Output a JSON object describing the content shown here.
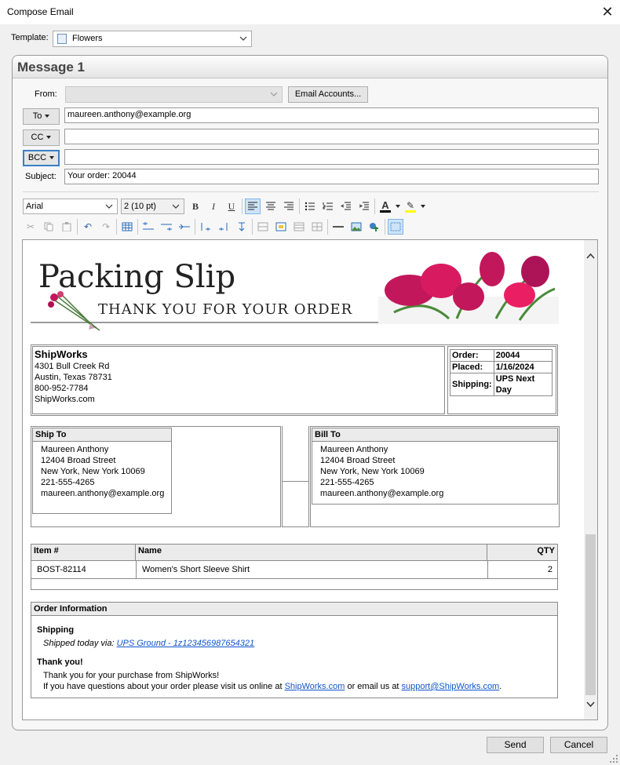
{
  "window": {
    "title": "Compose Email",
    "close_glyph": "✕"
  },
  "template": {
    "label": "Template:",
    "value": "Flowers"
  },
  "message": {
    "title": "Message 1",
    "from_label": "From:",
    "from_value": "",
    "email_accounts_label": "Email Accounts...",
    "to_label": "To",
    "to_value": "maureen.anthony@example.org",
    "cc_label": "CC",
    "cc_value": "",
    "bcc_label": "BCC",
    "bcc_value": "",
    "subject_label": "Subject:",
    "subject_value": "Your order: 20044"
  },
  "format": {
    "font": "Arial",
    "size": "2  (10 pt)",
    "bold": "B",
    "italic": "I",
    "underline": "U",
    "font_color_glyph": "A",
    "highlight_glyph": "✎"
  },
  "slip": {
    "title": "Packing Slip",
    "subtitle": "THANK YOU FOR YOUR ORDER",
    "company": {
      "name": "ShipWorks",
      "street": "4301 Bull Creek Rd",
      "city": "Austin, Texas 78731",
      "phone": "800-952-7784",
      "web": "ShipWorks.com"
    },
    "order": {
      "order_label": "Order:",
      "order_value": "20044",
      "placed_label": "Placed:",
      "placed_value": "1/16/2024",
      "shipping_label": "Shipping:",
      "shipping_value": "UPS Next Day"
    },
    "ship_to": {
      "title": "Ship To",
      "name": "Maureen Anthony",
      "street": "12404 Broad Street",
      "city": "New York, New York 10069",
      "phone": "221-555-4265",
      "email": "maureen.anthony@example.org"
    },
    "bill_to": {
      "title": "Bill To",
      "name": "Maureen Anthony",
      "street": "12404 Broad Street",
      "city": "New York, New York 10069",
      "phone": "221-555-4265",
      "email": "maureen.anthony@example.org"
    },
    "items": {
      "headers": [
        "Item #",
        "Name",
        "QTY"
      ],
      "rows": [
        {
          "sku": "BOST-82114",
          "name": "Women's Short Sleeve Shirt",
          "qty": "2"
        }
      ]
    },
    "order_info": {
      "title": "Order Information",
      "shipping_heading": "Shipping",
      "shipped_text": "Shipped today via: ",
      "tracking_link": "UPS Ground - 1z123456987654321",
      "thanks_heading": "Thank you!",
      "thanks_line": "Thank you for your purchase from ShipWorks!",
      "questions_prefix": "If you have questions about your order please visit us online at ",
      "site_link": "ShipWorks.com",
      "questions_middle": " or email us at ",
      "email_link": "support@ShipWorks.com",
      "questions_suffix": "."
    }
  },
  "footer": {
    "send_label": "Send",
    "cancel_label": "Cancel"
  },
  "colors": {
    "accent": "#3a7fc6",
    "link": "#1155cc",
    "flower": "#c2185b"
  }
}
